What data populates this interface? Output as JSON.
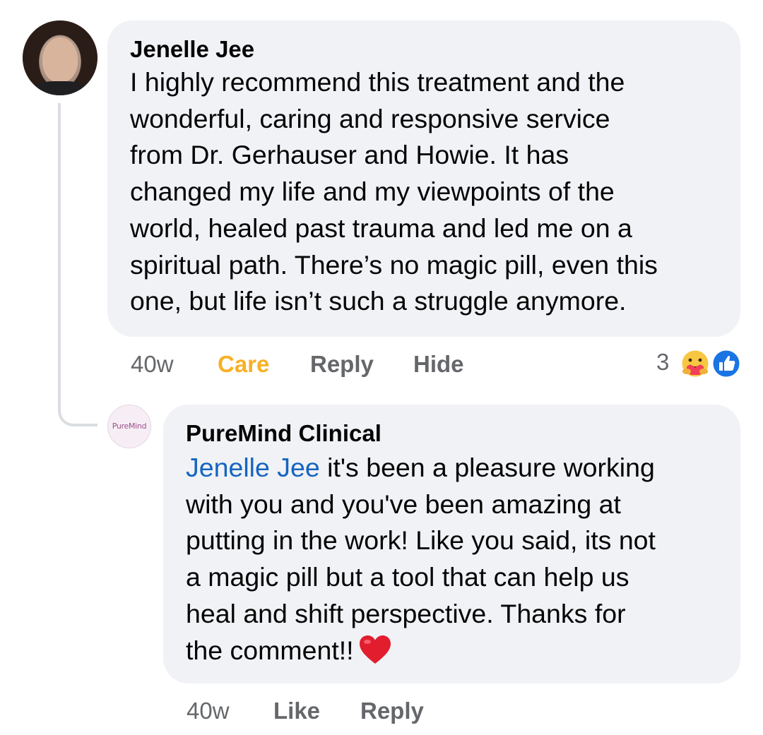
{
  "comment": {
    "author": "Jenelle Jee",
    "text": "I highly recommend this treatment and the\nwonderful, caring and responsive service\nfrom Dr. Gerhauser and Howie. It has\nchanged my life and my viewpoints of the\nworld, healed past trauma and led me on a\nspiritual path. There’s no magic pill, even this\none, but life isn’t such a struggle anymore.",
    "time": "40w",
    "reaction_label": "Care",
    "reply_label": "Reply",
    "hide_label": "Hide",
    "reaction_count": "3",
    "reaction_icons": [
      "care-emoji-icon",
      "like-thumb-icon"
    ],
    "colors": {
      "care": "#f7b125",
      "like_blue": "#1b74e4",
      "action_gray": "#65676b",
      "bubble_bg": "#f0f2f5"
    }
  },
  "reply": {
    "avatar_text": "PureMind",
    "author": "PureMind Clinical",
    "mention": "Jenelle Jee",
    "text": " it's been a pleasure working\nwith you and you've been amazing at\nputting in the work! Like you said, its not\na magic pill but a tool that can help us\nheal and shift perspective.  Thanks for\nthe comment!!",
    "emoji": "heart-emoji-icon",
    "time": "40w",
    "like_label": "Like",
    "reply_label": "Reply",
    "colors": {
      "mention": "#1665c0",
      "heart": "#e11d2e"
    }
  }
}
